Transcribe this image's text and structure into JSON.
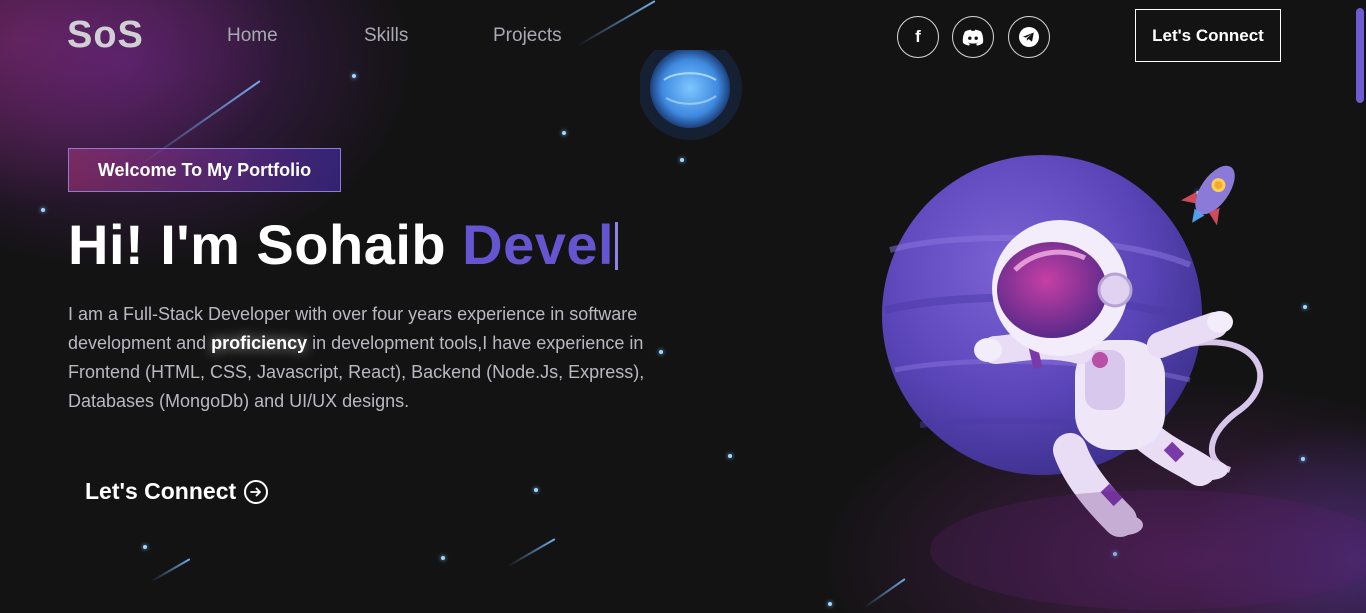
{
  "brand": {
    "logo": "SoS"
  },
  "nav": {
    "links": [
      {
        "label": "Home"
      },
      {
        "label": "Skills"
      },
      {
        "label": "Projects"
      }
    ],
    "social": [
      {
        "icon": "facebook-icon",
        "glyph": "f"
      },
      {
        "icon": "discord-icon"
      },
      {
        "icon": "telegram-icon"
      }
    ],
    "connect_label": "Let's Connect"
  },
  "hero": {
    "badge": "Welcome To My Portfolio",
    "greeting": "Hi! I'm Sohaib ",
    "typed_text": "Devel",
    "intro_part1": "I am a Full-Stack Developer with over four years experience in software development and ",
    "intro_highlight": "proficiency",
    "intro_part2": " in development tools,I have experience in Frontend (HTML, CSS, Javascript, React), Backend (Node.Js, Express), Databases (MongoDb) and UI/UX designs.",
    "cta_label": "Let's Connect",
    "cta_icon": "arrow-right-circle-icon"
  },
  "colors": {
    "accent": "#6655d0",
    "background": "#121212",
    "scroll_thumb": "#6c5ccf"
  }
}
